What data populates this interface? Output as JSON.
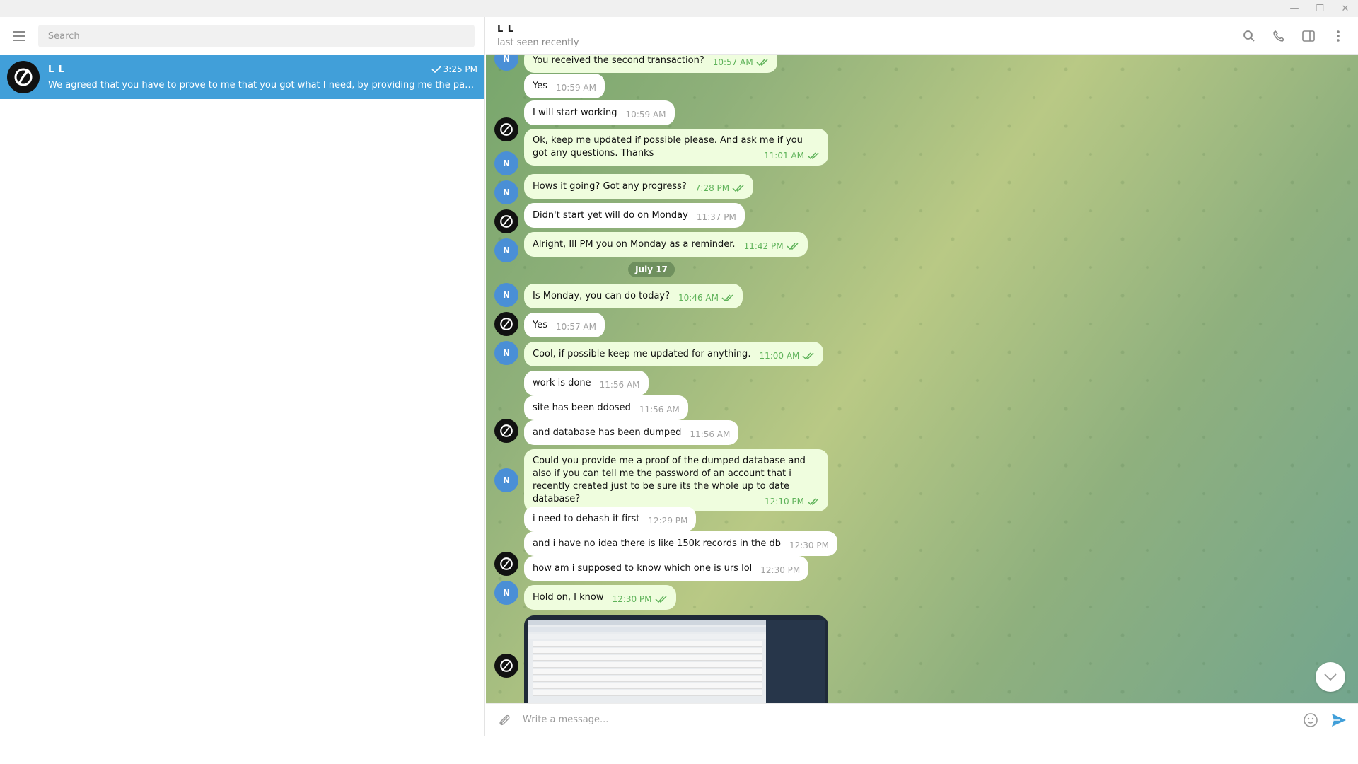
{
  "window": {
    "min_icon": "minimize-icon",
    "max_icon": "maximize-icon",
    "close_icon": "close-icon"
  },
  "sidebar": {
    "search_placeholder": "Search",
    "chat": {
      "name": "L L",
      "time": "3:25 PM",
      "preview": "We agreed that you have to prove to me that you got what I need, by providing me the password of an account that i recently created"
    }
  },
  "header": {
    "name": "L L",
    "status": "last seen recently"
  },
  "colors": {
    "accent": "#419fd9",
    "outgoing_bubble": "#effdde",
    "read_check": "#5fb35a"
  },
  "messages": [
    {
      "from": "N",
      "dir": "out",
      "text": "You received the second transaction?",
      "time": "10:57 AM"
    },
    {
      "from": "",
      "dir": "in",
      "text": "Yes",
      "time": "10:59 AM"
    },
    {
      "from": "LL",
      "dir": "in",
      "text": "I will start working",
      "time": "10:59 AM"
    },
    {
      "from": "N",
      "dir": "out",
      "text": "Ok, keep me updated if possible please. And ask me if you got any questions. Thanks",
      "time": "11:01 AM"
    },
    {
      "from": "N",
      "dir": "out",
      "text": "Hows it going? Got any progress?",
      "time": "7:28 PM"
    },
    {
      "from": "LL",
      "dir": "in",
      "text": "Didn't start yet will do on Monday",
      "time": "11:37 PM"
    },
    {
      "from": "N",
      "dir": "out",
      "text": "Alright, Ill PM you on Monday as a reminder.",
      "time": "11:42 PM"
    },
    {
      "from": "N",
      "dir": "out",
      "text": "Is Monday, you can do today?",
      "time": "10:46 AM"
    },
    {
      "from": "LL",
      "dir": "in",
      "text": "Yes",
      "time": "10:57 AM"
    },
    {
      "from": "N",
      "dir": "out",
      "text": "Cool, if possible keep me updated for anything.",
      "time": "11:00 AM"
    },
    {
      "from": "",
      "dir": "in",
      "text": "work is done",
      "time": "11:56 AM"
    },
    {
      "from": "",
      "dir": "in",
      "text": "site has been ddosed",
      "time": "11:56 AM"
    },
    {
      "from": "LL",
      "dir": "in",
      "text": "and database has been dumped",
      "time": "11:56 AM"
    },
    {
      "from": "N",
      "dir": "out",
      "text": "Could you provide me a proof of the dumped database and also if you can tell me the password of an account that i recently created just to be sure its the whole up to date database?",
      "time": "12:10 PM"
    },
    {
      "from": "",
      "dir": "in",
      "text": "i need to dehash it first",
      "time": "12:29 PM"
    },
    {
      "from": "",
      "dir": "in",
      "text": "and i have no idea there is like 150k records in the db",
      "time": "12:30 PM"
    },
    {
      "from": "LL",
      "dir": "in",
      "text": "how am i supposed to know which one is urs lol",
      "time": "12:30 PM"
    },
    {
      "from": "N",
      "dir": "out",
      "text": "Hold on, I know",
      "time": "12:30 PM"
    }
  ],
  "date_separator": "July 17",
  "avatar_letter": "N",
  "composer": {
    "placeholder": "Write a message..."
  }
}
